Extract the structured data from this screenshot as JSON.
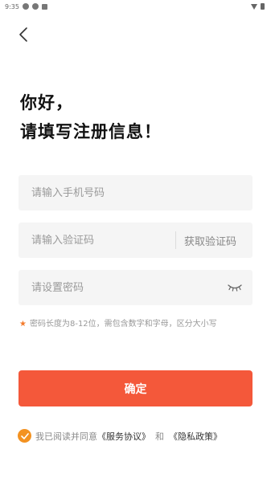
{
  "status_bar": {
    "time": "9:35"
  },
  "header": {
    "back_icon": "chevron-left-icon"
  },
  "title": {
    "line1": "你好，",
    "line2": "请填写注册信息！"
  },
  "form": {
    "phone_placeholder": "请输入手机号码",
    "code_placeholder": "请输入验证码",
    "get_code_label": "获取验证码",
    "password_placeholder": "请设置密码",
    "password_toggle_icon": "eye-closed-icon",
    "hint_star": "★",
    "hint_text": "密码长度为8-12位，需包含数字和字母，区分大小写"
  },
  "confirm_label": "确定",
  "agreement": {
    "checked": true,
    "prefix": "我已阅读并同意",
    "service_link": "《服务协议》",
    "and": "和",
    "privacy_link": "《隐私政策》"
  },
  "colors": {
    "primary": "#f4583a",
    "check": "#f39221",
    "hint_star": "#f37a2b",
    "input_bg": "#f5f5f5"
  }
}
